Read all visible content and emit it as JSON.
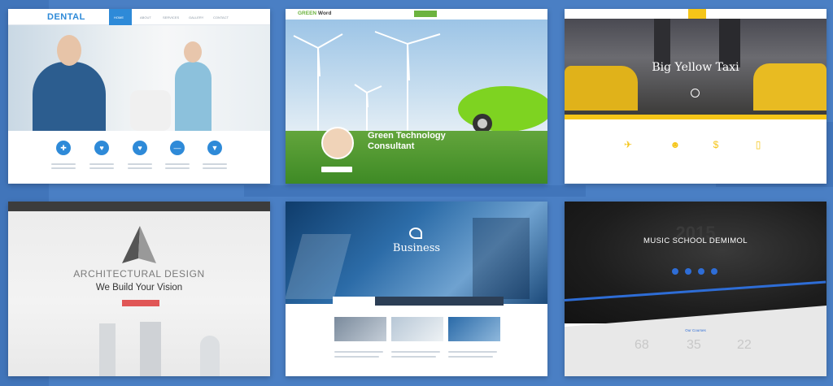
{
  "templates": [
    {
      "id": "dental",
      "logo": "DENTAL",
      "nav": [
        "HOME",
        "ABOUT",
        "SERVICES",
        "GALLERY",
        "CONTACT"
      ],
      "services": [
        {
          "icon": "clipboard-icon"
        },
        {
          "icon": "tooth-icon"
        },
        {
          "icon": "tooth-icon"
        },
        {
          "icon": "brush-icon"
        },
        {
          "icon": "implant-icon"
        }
      ]
    },
    {
      "id": "green-word",
      "logo_green": "GREEN",
      "logo_rest": " Word",
      "headline_line1": "Green Technology",
      "headline_line2": "Consultant"
    },
    {
      "id": "taxi",
      "headline": "Big Yellow Taxi",
      "features": [
        {
          "icon": "plane-icon"
        },
        {
          "icon": "people-icon"
        },
        {
          "icon": "dollar-icon"
        },
        {
          "icon": "phone-icon"
        }
      ]
    },
    {
      "id": "architecture",
      "headline": "ARCHITECTURAL DESIGN",
      "subheadline": "We Build Your Vision"
    },
    {
      "id": "business",
      "headline": "Business"
    },
    {
      "id": "music",
      "headline": "MUSIC SCHOOL DEMIMOL",
      "year": "2015",
      "section_title": "Our Courses",
      "stats": [
        "68",
        "35",
        "22"
      ]
    }
  ]
}
